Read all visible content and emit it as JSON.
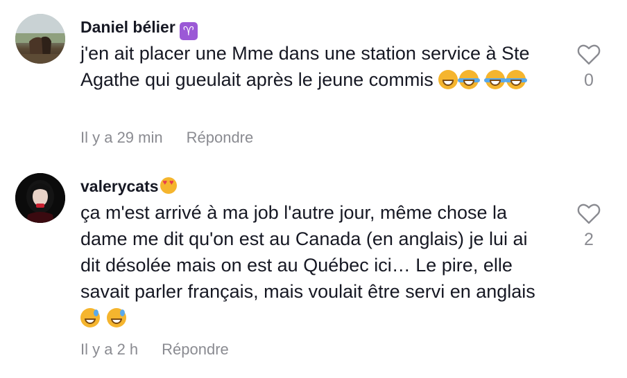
{
  "comments": [
    {
      "username": "Daniel bélier",
      "badge": "♈",
      "text_line1": "j'en ait placer une Mme dans une station service à Ste Agathe qui gueulait après le jeune commis",
      "time": "Il y a 29 min",
      "reply_label": "Répondre",
      "likes": "0",
      "emojis": [
        "grin-icon",
        "joy-icon",
        "joy-icon",
        "joy-icon"
      ]
    },
    {
      "username": "valerycats",
      "text_line1": "ça m'est arrivé à ma job l'autre jour, même chose la dame me dit qu'on est au Canada (en anglais) je lui ai dit désolée mais on est au Québec ici… Le pire, elle savait parler français, mais voulait être servi en anglais",
      "time": "Il y a 2 h",
      "reply_label": "Répondre",
      "likes": "2",
      "emojis": [
        "sweat-smile-icon",
        "sweat-smile-icon"
      ]
    }
  ]
}
